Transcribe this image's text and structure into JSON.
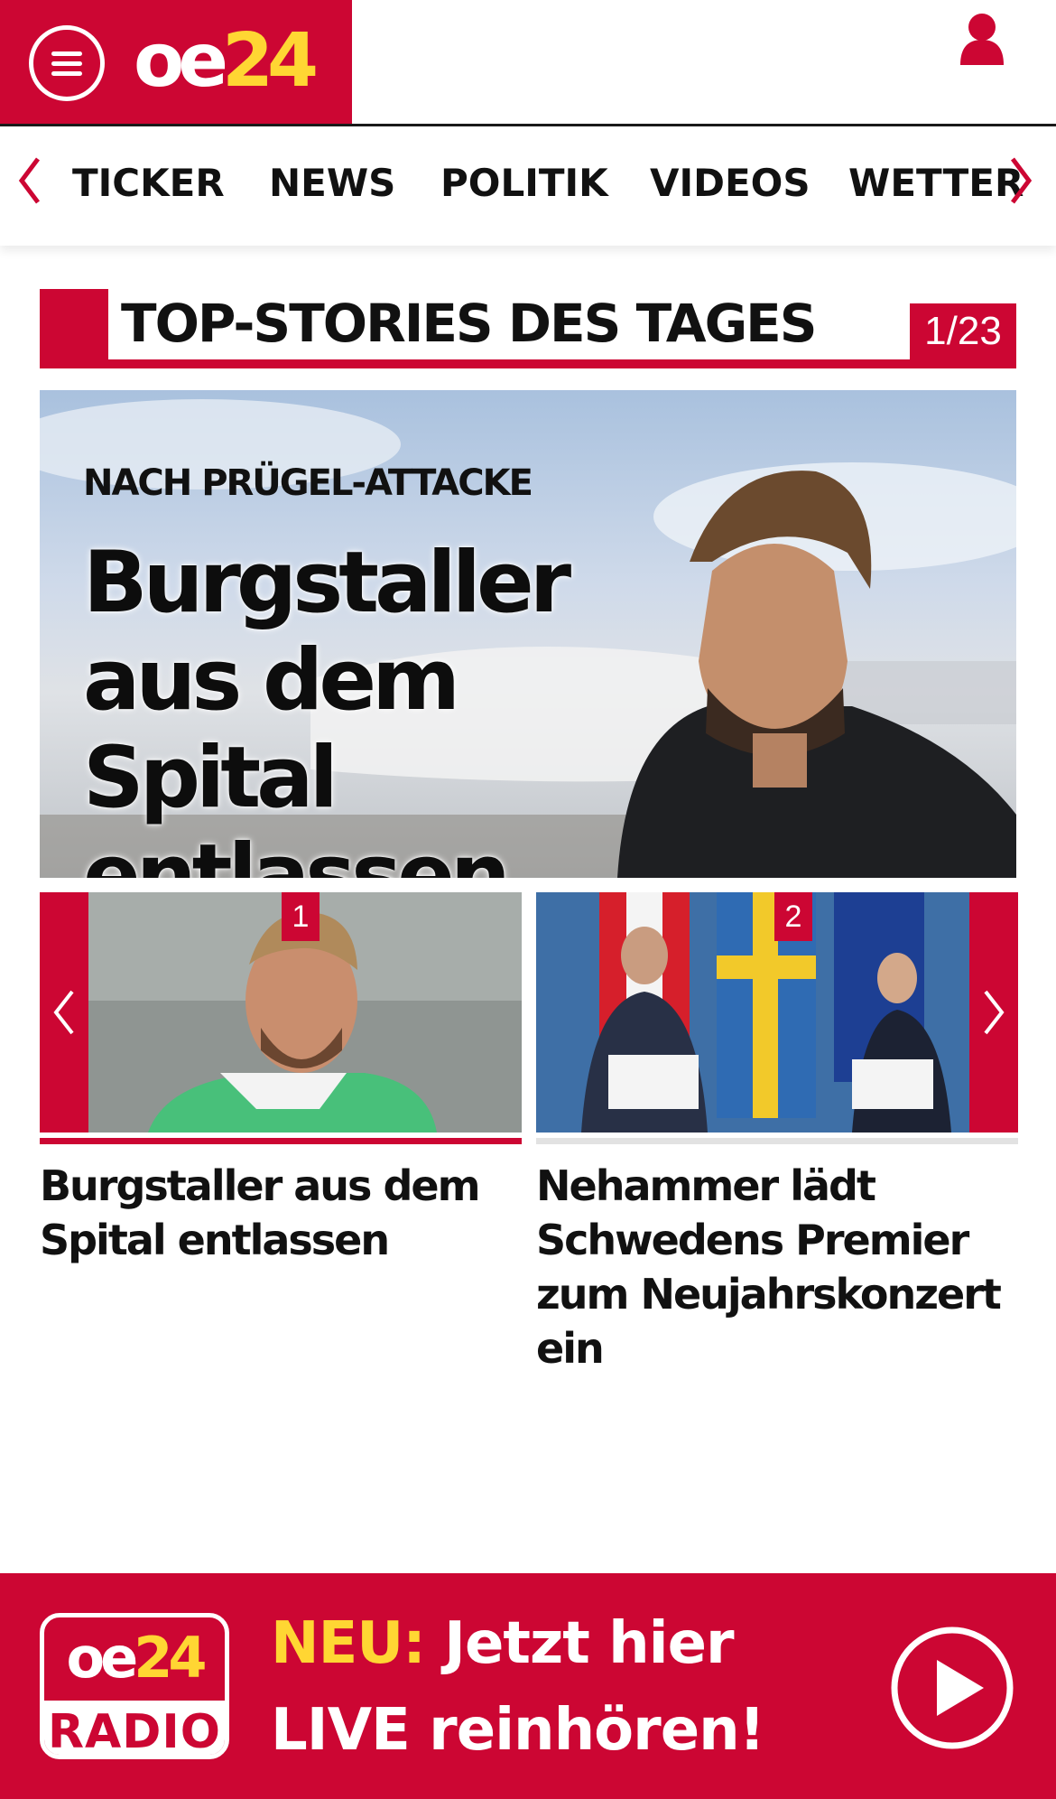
{
  "header": {
    "logo": {
      "oe": "oe",
      "num": "24"
    },
    "menu_icon": "hamburger-menu-icon",
    "account_icon": "user-icon"
  },
  "nav": {
    "items": [
      "TICKER",
      "NEWS",
      "POLITIK",
      "VIDEOS",
      "WETTER"
    ],
    "left_icon": "chevron-left-icon",
    "right_icon": "chevron-right-icon"
  },
  "section": {
    "title": "TOP-STORIES DES TAGES",
    "counter": "1/23"
  },
  "hero": {
    "kicker": "NACH PRÜGEL-ATTACKE",
    "headline": "Burgstaller aus dem Spital entlassen"
  },
  "cards": [
    {
      "number": "1",
      "headline": "Burgstaller aus dem Spital entlassen"
    },
    {
      "number": "2",
      "headline": "Nehammer lädt Schwedens Premier zum Neujahrskonzert ein"
    }
  ],
  "banner": {
    "radio_logo": {
      "oe": "oe",
      "num": "24",
      "label": "RADIO"
    },
    "new_label": "NEU:",
    "line1": "Jetzt hier",
    "line2": "LIVE reinhören!",
    "play_icon": "play-icon"
  },
  "colors": {
    "brand_red": "#cc0633",
    "accent_yellow": "#ffd633"
  }
}
